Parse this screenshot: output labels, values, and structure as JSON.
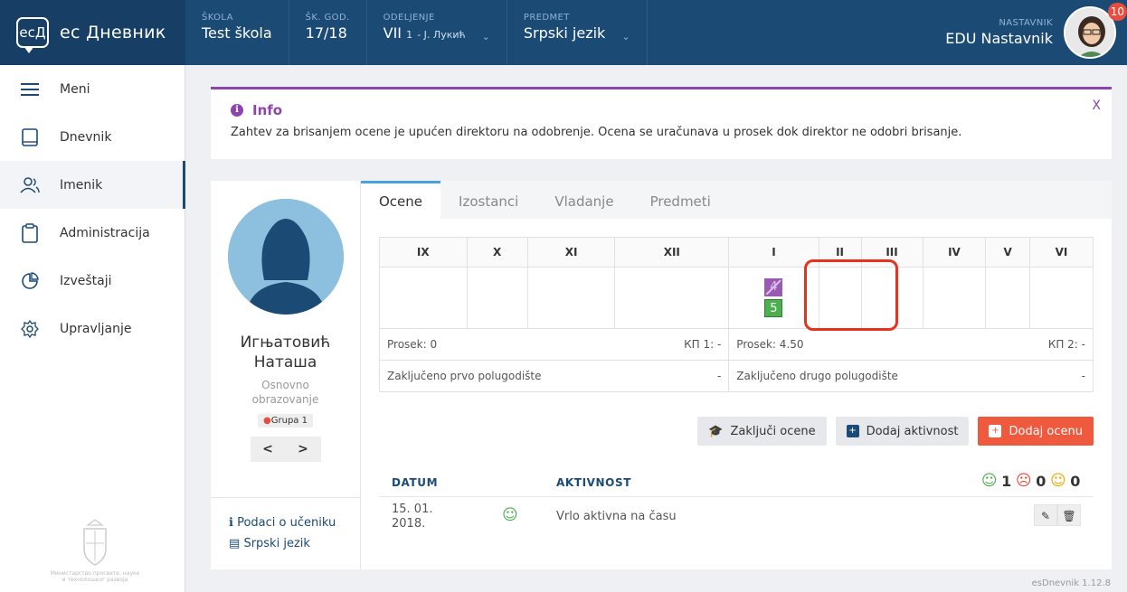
{
  "topbar": {
    "logo_mark": "ecД",
    "logo_text": "ес Дневник",
    "skola_label": "ŠKOLA",
    "skola_value": "Test škola",
    "god_label": "ŠK. GOD.",
    "god_value": "17/18",
    "odeljenje_label": "ODELJENJE",
    "odeljenje_value": "VII",
    "odeljenje_sub": "1",
    "odeljenje_teacher": "- J. Лукић",
    "predmet_label": "PREDMET",
    "predmet_value": "Srpski jezik",
    "user_label": "NASTAVNIK",
    "user_name": "EDU Nastavnik",
    "badge_count": "10"
  },
  "sidebar": {
    "items": [
      {
        "label": "Meni",
        "icon": "menu-icon"
      },
      {
        "label": "Dnevnik",
        "icon": "book-icon"
      },
      {
        "label": "Imenik",
        "icon": "users-icon"
      },
      {
        "label": "Administracija",
        "icon": "clipboard-icon"
      },
      {
        "label": "Izveštaji",
        "icon": "pie-chart-icon"
      },
      {
        "label": "Upravljanje",
        "icon": "gear-icon"
      }
    ],
    "crest_text": "Министарство просвете, науке и технолошког развоја"
  },
  "info": {
    "title": "Info",
    "text": "Zahtev za brisanjem ocene je upućen direktoru na odobrenje. Ocena se uračunava u prosek dok direktor ne odobri brisanje.",
    "close": "X"
  },
  "student": {
    "first_line": "Игњатовић",
    "second_line": "Наташа",
    "education": "Osnovno obrazovanje",
    "group": "Grupa 1",
    "prev": "<",
    "next": ">",
    "link_details": "Podaci o učeniku",
    "link_subject": "Srpski jezik"
  },
  "tabs": [
    "Ocene",
    "Izostanci",
    "Vladanje",
    "Predmeti"
  ],
  "grades": {
    "months": [
      "IX",
      "X",
      "XI",
      "XII",
      "I",
      "II",
      "III",
      "IV",
      "V",
      "VI"
    ],
    "deleted_grade": "4",
    "active_grade": "5",
    "prosek1": "Prosek: 0",
    "kp1": "КП 1: -",
    "prosek2": "Prosek: 4.50",
    "kp2": "КП 2: -",
    "zak1": "Zaključeno prvo polugodište",
    "zak1_val": "-",
    "zak2": "Zaključeno drugo polugodište",
    "zak2_val": "-"
  },
  "buttons": {
    "close_grades": "Zaključi ocene",
    "add_activity": "Dodaj aktivnost",
    "add_grade": "Dodaj ocenu"
  },
  "activity": {
    "col_date": "DATUM",
    "col_activity": "AKTIVNOST",
    "count_good": "1",
    "count_bad": "0",
    "count_neutral": "0",
    "rows": [
      {
        "date_line1": "15. 01.",
        "date_line2": "2018.",
        "text": "Vrlo aktivna na času"
      }
    ]
  },
  "version": "esDnevnik 1.12.8"
}
